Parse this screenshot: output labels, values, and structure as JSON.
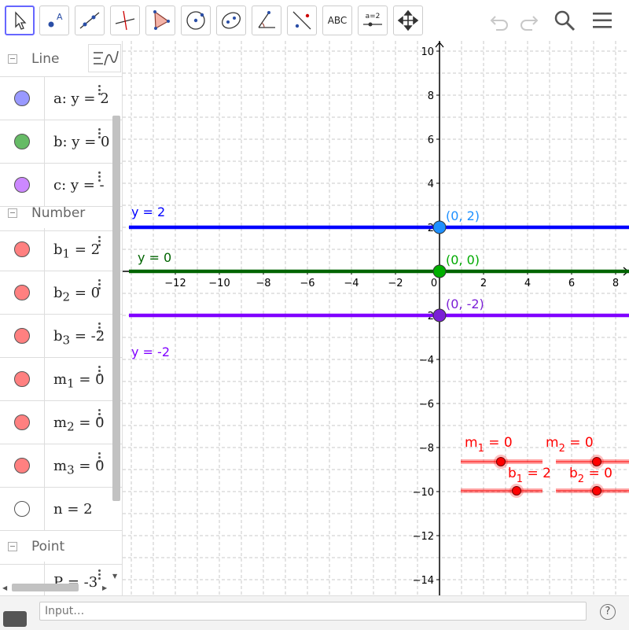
{
  "toolbar": {
    "abc_label": "ABC",
    "slider_label": "a=2",
    "point_letter": "A"
  },
  "input": {
    "placeholder": "Input…"
  },
  "help_label": "?",
  "algebra": {
    "groups": {
      "line": "Line",
      "number": "Number",
      "point": "Point"
    },
    "items": [
      {
        "text": "a: y = 2",
        "color": "#9999ff"
      },
      {
        "text": "b: y = 0",
        "color": "#66bb66"
      },
      {
        "text": "c: y = -",
        "color": "#cc88ff"
      },
      {
        "name": "b",
        "sub": "1",
        "value": "= 2",
        "color": "#ff8080"
      },
      {
        "name": "b",
        "sub": "2",
        "value": "= 0",
        "color": "#ff8080"
      },
      {
        "name": "b",
        "sub": "3",
        "value": "= -2",
        "color": "#ff8080"
      },
      {
        "name": "m",
        "sub": "1",
        "value": "= 0",
        "color": "#ff8080"
      },
      {
        "name": "m",
        "sub": "2",
        "value": "= 0",
        "color": "#ff8080"
      },
      {
        "name": "m",
        "sub": "3",
        "value": "= 0",
        "color": "#ff8080"
      },
      {
        "text": "n = 2",
        "color": "#ffffff"
      },
      {
        "text": "P = -3",
        "color": "#ffffff"
      }
    ]
  },
  "graph": {
    "x_ticks": [
      -12,
      -10,
      -8,
      -6,
      -4,
      -2,
      0,
      2,
      4,
      6,
      8
    ],
    "y_ticks": [
      10,
      8,
      6,
      4,
      2,
      -2,
      -4,
      -6,
      -8,
      -10,
      -12,
      -14
    ],
    "lines": [
      {
        "label": "y = 2",
        "y": 2,
        "color": "#0000ff",
        "point_label": "(0, 2)",
        "point_color": "#1e90ff",
        "label_color": "#1e90ff"
      },
      {
        "label": "y = 0",
        "y": 0,
        "color": "#006400",
        "point_label": "(0, 0)",
        "point_color": "#00b000",
        "label_color": "#00aa00"
      },
      {
        "label": "y = -2",
        "y": -2,
        "color": "#8000ff",
        "point_label": "(0, -2)",
        "point_color": "#7b1fd6",
        "label_color": "#7b1fd6"
      }
    ],
    "sliders": [
      {
        "name": "m",
        "sub": "1",
        "value": "= 0"
      },
      {
        "name": "m",
        "sub": "2",
        "value": "= 0"
      },
      {
        "name": "b",
        "sub": "1",
        "value": "= 2"
      },
      {
        "name": "b",
        "sub": "2",
        "value": "= 0"
      }
    ],
    "slider_color": "#ff0000"
  }
}
